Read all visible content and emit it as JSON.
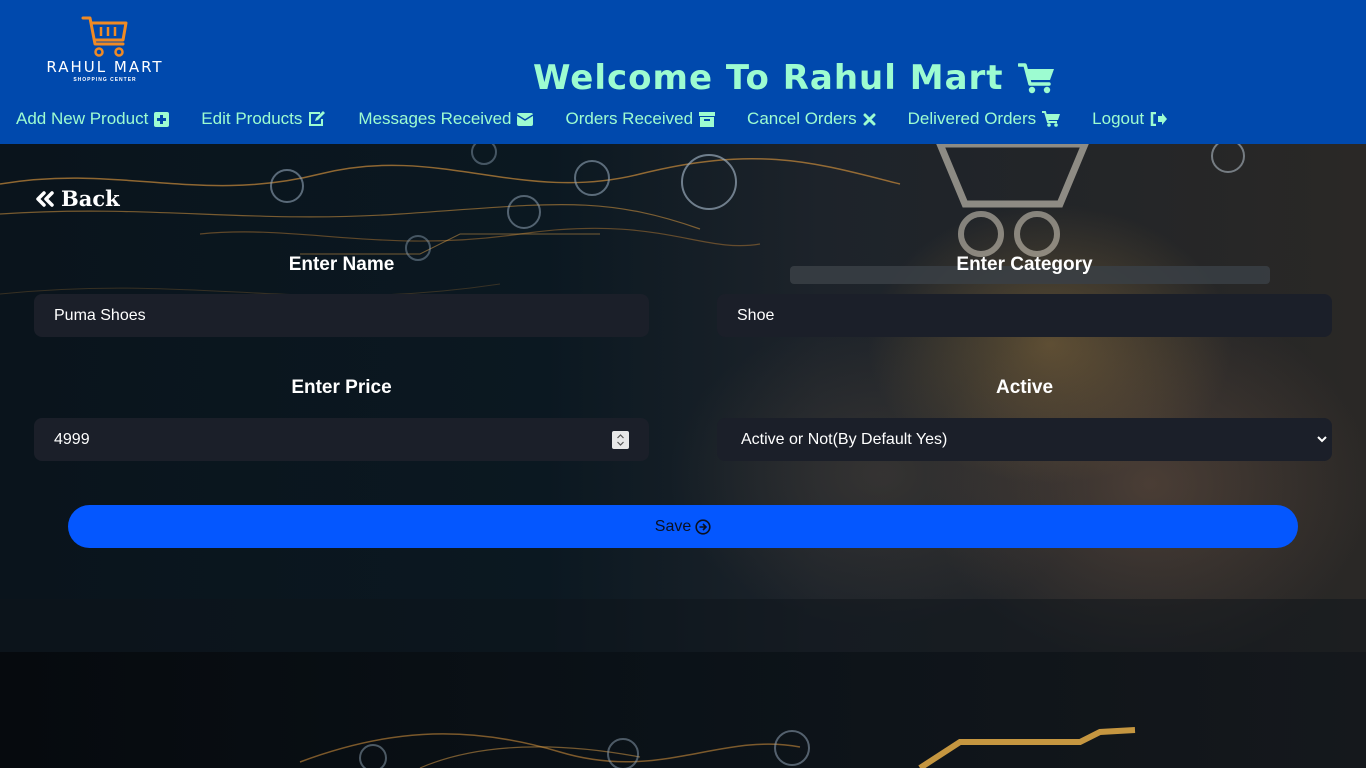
{
  "logo": {
    "name": "RAHUL MART",
    "subtitle": "SHOPPING CENTER"
  },
  "header": {
    "welcome": "Welcome To Rahul Mart"
  },
  "nav": [
    {
      "label": "Add New Product",
      "icon": "plus-square-icon"
    },
    {
      "label": "Edit Products",
      "icon": "edit-icon"
    },
    {
      "label": "Messages Received",
      "icon": "envelope-icon"
    },
    {
      "label": "Orders Received",
      "icon": "archive-icon"
    },
    {
      "label": "Cancel Orders",
      "icon": "times-icon"
    },
    {
      "label": "Delivered Orders",
      "icon": "cart-icon"
    },
    {
      "label": "Logout",
      "icon": "sign-out-icon"
    }
  ],
  "form": {
    "back_label": "Back",
    "name_label": "Enter Name",
    "name_value": "Puma Shoes",
    "category_label": "Enter Category",
    "category_value": "Shoe",
    "price_label": "Enter Price",
    "price_value": "4999",
    "active_label": "Active",
    "active_value": "Active or Not(By Default Yes)",
    "save_label": "Save"
  },
  "colors": {
    "header_bg": "#0049ad",
    "accent_text": "#9dfcd1",
    "input_bg": "#1b1f29",
    "save_button": "#0457ff"
  }
}
